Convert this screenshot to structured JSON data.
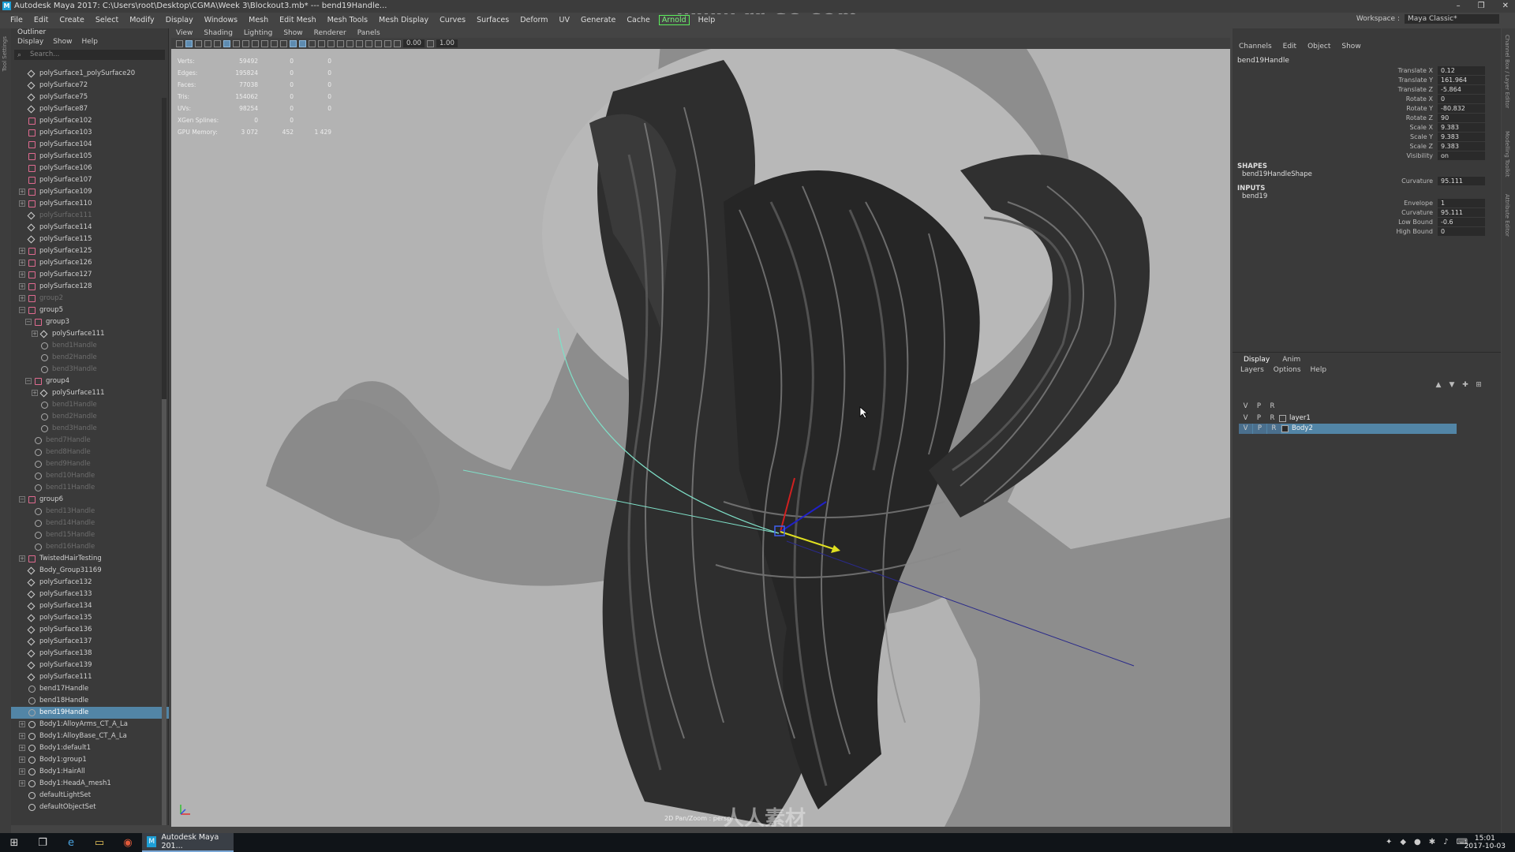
{
  "title_bar": {
    "text": "Autodesk Maya 2017: C:\\Users\\root\\Desktop\\CGMA\\Week 3\\Blockout3.mb*  ---  bend19Handle...",
    "controls": [
      "–",
      "❐",
      "✕"
    ]
  },
  "watermark_top": "www.rr-sc.com",
  "main_menu": {
    "items": [
      "File",
      "Edit",
      "Create",
      "Select",
      "Modify",
      "Display",
      "Windows",
      "Mesh",
      "Edit Mesh",
      "Mesh Tools",
      "Mesh Display",
      "Curves",
      "Surfaces",
      "Deform",
      "UV",
      "Generate",
      "Cache",
      "Arnold",
      "Help"
    ],
    "workspace_label": "Workspace :",
    "workspace_value": "Maya Classic*"
  },
  "left_strip_label": "Tool Settings",
  "outliner": {
    "title": "Outliner",
    "menu": [
      "Display",
      "Show",
      "Help"
    ],
    "search_placeholder": "Search...",
    "rows": [
      {
        "label": "polySurface1_polySurface20",
        "indent": 1,
        "icon": "mesh",
        "exp": "",
        "dim": false
      },
      {
        "label": "polySurface72",
        "indent": 1,
        "icon": "mesh",
        "exp": "",
        "dim": false
      },
      {
        "label": "polySurface75",
        "indent": 1,
        "icon": "mesh",
        "exp": "",
        "dim": false
      },
      {
        "label": "polySurface87",
        "indent": 1,
        "icon": "mesh",
        "exp": "",
        "dim": false
      },
      {
        "label": "polySurface102",
        "indent": 1,
        "icon": "group",
        "exp": "",
        "dim": false
      },
      {
        "label": "polySurface103",
        "indent": 1,
        "icon": "group",
        "exp": "",
        "dim": false
      },
      {
        "label": "polySurface104",
        "indent": 1,
        "icon": "group",
        "exp": "",
        "dim": false
      },
      {
        "label": "polySurface105",
        "indent": 1,
        "icon": "group",
        "exp": "",
        "dim": false
      },
      {
        "label": "polySurface106",
        "indent": 1,
        "icon": "group",
        "exp": "",
        "dim": false
      },
      {
        "label": "polySurface107",
        "indent": 1,
        "icon": "group",
        "exp": "",
        "dim": false
      },
      {
        "label": "polySurface109",
        "indent": 1,
        "icon": "group",
        "exp": "+",
        "dim": false
      },
      {
        "label": "polySurface110",
        "indent": 1,
        "icon": "group",
        "exp": "+",
        "dim": false
      },
      {
        "label": "polySurface111",
        "indent": 1,
        "icon": "mesh",
        "exp": "",
        "dim": true
      },
      {
        "label": "polySurface114",
        "indent": 1,
        "icon": "mesh",
        "exp": "",
        "dim": false
      },
      {
        "label": "polySurface115",
        "indent": 1,
        "icon": "mesh",
        "exp": "",
        "dim": false
      },
      {
        "label": "polySurface125",
        "indent": 1,
        "icon": "group",
        "exp": "+",
        "dim": false
      },
      {
        "label": "polySurface126",
        "indent": 1,
        "icon": "group",
        "exp": "+",
        "dim": false
      },
      {
        "label": "polySurface127",
        "indent": 1,
        "icon": "group",
        "exp": "+",
        "dim": false
      },
      {
        "label": "polySurface128",
        "indent": 1,
        "icon": "group",
        "exp": "+",
        "dim": false
      },
      {
        "label": "group2",
        "indent": 1,
        "icon": "group",
        "exp": "+",
        "dim": true
      },
      {
        "label": "group5",
        "indent": 1,
        "icon": "group",
        "exp": "−",
        "dim": false
      },
      {
        "label": "group3",
        "indent": 2,
        "icon": "group",
        "exp": "−",
        "dim": false
      },
      {
        "label": "polySurface111",
        "indent": 3,
        "icon": "mesh",
        "exp": "+",
        "dim": false
      },
      {
        "label": "bend1Handle",
        "indent": 3,
        "icon": "handle",
        "exp": "",
        "dim": true
      },
      {
        "label": "bend2Handle",
        "indent": 3,
        "icon": "handle",
        "exp": "",
        "dim": true
      },
      {
        "label": "bend3Handle",
        "indent": 3,
        "icon": "handle",
        "exp": "",
        "dim": true
      },
      {
        "label": "group4",
        "indent": 2,
        "icon": "group",
        "exp": "−",
        "dim": false
      },
      {
        "label": "polySurface111",
        "indent": 3,
        "icon": "mesh",
        "exp": "+",
        "dim": false
      },
      {
        "label": "bend1Handle",
        "indent": 3,
        "icon": "handle",
        "exp": "",
        "dim": true
      },
      {
        "label": "bend2Handle",
        "indent": 3,
        "icon": "handle",
        "exp": "",
        "dim": true
      },
      {
        "label": "bend3Handle",
        "indent": 3,
        "icon": "handle",
        "exp": "",
        "dim": true
      },
      {
        "label": "bend7Handle",
        "indent": 2,
        "icon": "handle",
        "exp": "",
        "dim": true
      },
      {
        "label": "bend8Handle",
        "indent": 2,
        "icon": "handle",
        "exp": "",
        "dim": true
      },
      {
        "label": "bend9Handle",
        "indent": 2,
        "icon": "handle",
        "exp": "",
        "dim": true
      },
      {
        "label": "bend10Handle",
        "indent": 2,
        "icon": "handle",
        "exp": "",
        "dim": true
      },
      {
        "label": "bend11Handle",
        "indent": 2,
        "icon": "handle",
        "exp": "",
        "dim": true
      },
      {
        "label": "group6",
        "indent": 1,
        "icon": "group",
        "exp": "−",
        "dim": false
      },
      {
        "label": "bend13Handle",
        "indent": 2,
        "icon": "handle",
        "exp": "",
        "dim": true
      },
      {
        "label": "bend14Handle",
        "indent": 2,
        "icon": "handle",
        "exp": "",
        "dim": true
      },
      {
        "label": "bend15Handle",
        "indent": 2,
        "icon": "handle",
        "exp": "",
        "dim": true
      },
      {
        "label": "bend16Handle",
        "indent": 2,
        "icon": "handle",
        "exp": "",
        "dim": true
      },
      {
        "label": "TwistedHairTesting",
        "indent": 1,
        "icon": "group",
        "exp": "+",
        "dim": false
      },
      {
        "label": "Body_Group31169",
        "indent": 1,
        "icon": "mesh",
        "exp": "",
        "dim": false
      },
      {
        "label": "polySurface132",
        "indent": 1,
        "icon": "mesh",
        "exp": "",
        "dim": false
      },
      {
        "label": "polySurface133",
        "indent": 1,
        "icon": "mesh",
        "exp": "",
        "dim": false
      },
      {
        "label": "polySurface134",
        "indent": 1,
        "icon": "mesh",
        "exp": "",
        "dim": false
      },
      {
        "label": "polySurface135",
        "indent": 1,
        "icon": "mesh",
        "exp": "",
        "dim": false
      },
      {
        "label": "polySurface136",
        "indent": 1,
        "icon": "mesh",
        "exp": "",
        "dim": false
      },
      {
        "label": "polySurface137",
        "indent": 1,
        "icon": "mesh",
        "exp": "",
        "dim": false
      },
      {
        "label": "polySurface138",
        "indent": 1,
        "icon": "mesh",
        "exp": "",
        "dim": false
      },
      {
        "label": "polySurface139",
        "indent": 1,
        "icon": "mesh",
        "exp": "",
        "dim": false
      },
      {
        "label": "polySurface111",
        "indent": 1,
        "icon": "mesh",
        "exp": "",
        "dim": false
      },
      {
        "label": "bend17Handle",
        "indent": 1,
        "icon": "handle",
        "exp": "",
        "dim": false
      },
      {
        "label": "bend18Handle",
        "indent": 1,
        "icon": "handle",
        "exp": "",
        "dim": false
      },
      {
        "label": "bend19Handle",
        "indent": 1,
        "icon": "handle",
        "exp": "",
        "dim": false,
        "selected": true
      },
      {
        "label": "Body1:AlloyArms_CT_A_La",
        "indent": 1,
        "icon": "set",
        "exp": "+",
        "dim": false
      },
      {
        "label": "Body1:AlloyBase_CT_A_La",
        "indent": 1,
        "icon": "set",
        "exp": "+",
        "dim": false
      },
      {
        "label": "Body1:default1",
        "indent": 1,
        "icon": "set",
        "exp": "+",
        "dim": false
      },
      {
        "label": "Body1:group1",
        "indent": 1,
        "icon": "set",
        "exp": "+",
        "dim": false
      },
      {
        "label": "Body1:HairAll",
        "indent": 1,
        "icon": "set",
        "exp": "+",
        "dim": false
      },
      {
        "label": "Body1:HeadA_mesh1",
        "indent": 1,
        "icon": "set",
        "exp": "+",
        "dim": false
      },
      {
        "label": "defaultLightSet",
        "indent": 1,
        "icon": "set",
        "exp": "",
        "dim": false
      },
      {
        "label": "defaultObjectSet",
        "indent": 1,
        "icon": "set",
        "exp": "",
        "dim": false
      }
    ]
  },
  "viewport": {
    "menu": [
      "View",
      "Shading",
      "Lighting",
      "Show",
      "Renderer",
      "Panels"
    ],
    "toolbar_values": [
      "0.00",
      "1.00"
    ],
    "hud": [
      {
        "label": "Verts:",
        "v1": "59492",
        "v2": "0",
        "v3": "0"
      },
      {
        "label": "Edges:",
        "v1": "195824",
        "v2": "0",
        "v3": "0"
      },
      {
        "label": "Faces:",
        "v1": "77038",
        "v2": "0",
        "v3": "0"
      },
      {
        "label": "Tris:",
        "v1": "154062",
        "v2": "0",
        "v3": "0"
      },
      {
        "label": "UVs:",
        "v1": "98254",
        "v2": "0",
        "v3": "0"
      },
      {
        "label": "XGen Splines:",
        "v1": "0",
        "v2": "0",
        "v3": ""
      },
      {
        "label": "GPU Memory:",
        "v1": "3 072",
        "v2": "452",
        "v3": "1 429"
      }
    ],
    "footer": "2D Pan/Zoom : persp",
    "watermark_bottom": "人人素材"
  },
  "channel_box": {
    "menu": [
      "Channels",
      "Edit",
      "Object",
      "Show"
    ],
    "object_name": "bend19Handle",
    "attributes": [
      {
        "name": "Translate X",
        "value": "0.12"
      },
      {
        "name": "Translate Y",
        "value": "161.964"
      },
      {
        "name": "Translate Z",
        "value": "-5.864"
      },
      {
        "name": "Rotate X",
        "value": "0"
      },
      {
        "name": "Rotate Y",
        "value": "-80.832"
      },
      {
        "name": "Rotate Z",
        "value": "90"
      },
      {
        "name": "Scale X",
        "value": "9.383"
      },
      {
        "name": "Scale Y",
        "value": "9.383"
      },
      {
        "name": "Scale Z",
        "value": "9.383"
      },
      {
        "name": "Visibility",
        "value": "on"
      }
    ],
    "shapes_header": "SHAPES",
    "shape_name": "bend19HandleShape",
    "shape_attrs": [
      {
        "name": "Curvature",
        "value": "95.111"
      }
    ],
    "inputs_header": "INPUTS",
    "input_name": "bend19",
    "input_attrs": [
      {
        "name": "Envelope",
        "value": "1"
      },
      {
        "name": "Curvature",
        "value": "95.111"
      },
      {
        "name": "Low Bound",
        "value": "-0.6"
      },
      {
        "name": "High Bound",
        "value": "0"
      }
    ]
  },
  "layer_editor": {
    "tabs": [
      "Display",
      "Anim"
    ],
    "menu": [
      "Layers",
      "Options",
      "Help"
    ],
    "header_cols": [
      "V",
      "P",
      "R"
    ],
    "rows": [
      {
        "v": "V",
        "p": "P",
        "r": "R",
        "name": "layer1",
        "selected": false
      },
      {
        "v": "V",
        "p": "P",
        "r": "R",
        "name": "Body2",
        "selected": true
      }
    ]
  },
  "right_tabs": [
    "Channel Box / Layer Editor",
    "Modelling Toolkit",
    "Attribute Editor"
  ],
  "taskbar": {
    "app_label": "Autodesk Maya 201...",
    "time": "15:01",
    "date": "2017-10-03"
  },
  "colors": {
    "selection": "#5285a6",
    "viewport_bg": "#b6b6b6",
    "arnold_highlight": "#5cf05c"
  }
}
